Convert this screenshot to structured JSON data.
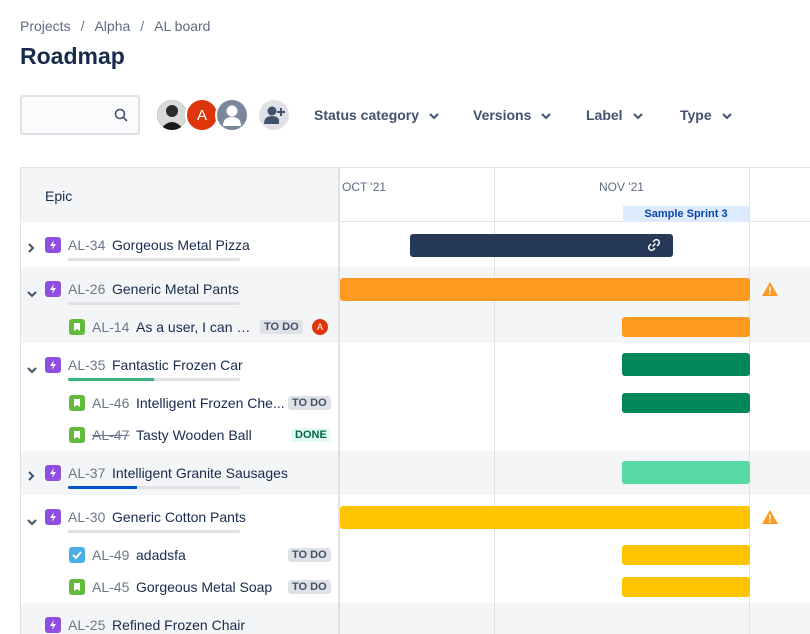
{
  "breadcrumb": [
    "Projects",
    "Alpha",
    "AL board"
  ],
  "page_title": "Roadmap",
  "search": {
    "placeholder": "",
    "icon": "search-icon"
  },
  "avatars": [
    {
      "kind": "photo",
      "icon": "user-photo"
    },
    {
      "kind": "initial",
      "initial": "A",
      "color": "#de350b"
    },
    {
      "kind": "default",
      "icon": "default-user-icon"
    },
    {
      "kind": "add",
      "icon": "add-user-icon"
    }
  ],
  "filters": [
    {
      "label": "Status category"
    },
    {
      "label": "Versions"
    },
    {
      "label": "Label"
    },
    {
      "label": "Type"
    }
  ],
  "left_header": "Epic",
  "timeline": {
    "months": [
      "OCT '21",
      "NOV '21"
    ],
    "sprint": "Sample Sprint 3"
  },
  "rows": [
    {
      "type": "epic",
      "expanded": false,
      "key": "AL-34",
      "title": "Gorgeous Metal Pizza",
      "progress": 0,
      "bar_color": "#253858",
      "linked": true
    },
    {
      "type": "epic",
      "expanded": true,
      "key": "AL-26",
      "title": "Generic Metal Pants",
      "progress": 0,
      "bar_color": "#ff991f",
      "warning": true
    },
    {
      "type": "story",
      "key": "AL-14",
      "title": "As a user, I can fi...",
      "status": "TO DO",
      "assignee": "A",
      "bar_color": "#ff991f"
    },
    {
      "type": "epic",
      "expanded": true,
      "key": "AL-35",
      "title": "Fantastic Frozen Car",
      "progress": 0.5,
      "progress_color": "#36b37e",
      "bar_color": "#00875a"
    },
    {
      "type": "story",
      "key": "AL-46",
      "title": "Intelligent Frozen Che...",
      "status": "TO DO",
      "bar_color": "#00875a"
    },
    {
      "type": "story",
      "key": "AL-47",
      "title": "Tasty Wooden Ball",
      "status": "DONE",
      "done": true
    },
    {
      "type": "epic",
      "expanded": false,
      "key": "AL-37",
      "title": "Intelligent Granite Sausages",
      "progress": 0.4,
      "progress_color": "#0052cc",
      "bar_color": "#57d9a3"
    },
    {
      "type": "epic",
      "expanded": true,
      "key": "AL-30",
      "title": "Generic Cotton Pants",
      "progress": 0,
      "bar_color": "#ffc400",
      "warning": true
    },
    {
      "type": "task",
      "key": "AL-49",
      "title": "adadsfa",
      "status": "TO DO",
      "bar_color": "#ffc400"
    },
    {
      "type": "story",
      "key": "AL-45",
      "title": "Gorgeous Metal Soap",
      "status": "TO DO",
      "bar_color": "#ffc400"
    },
    {
      "type": "epic",
      "expanded": false,
      "key": "AL-25",
      "title": "Refined Frozen Chair"
    }
  ],
  "colors": {
    "epic": "#904ee2",
    "story": "#63ba3c",
    "task": "#4bade8",
    "warning": "#ff991f"
  }
}
